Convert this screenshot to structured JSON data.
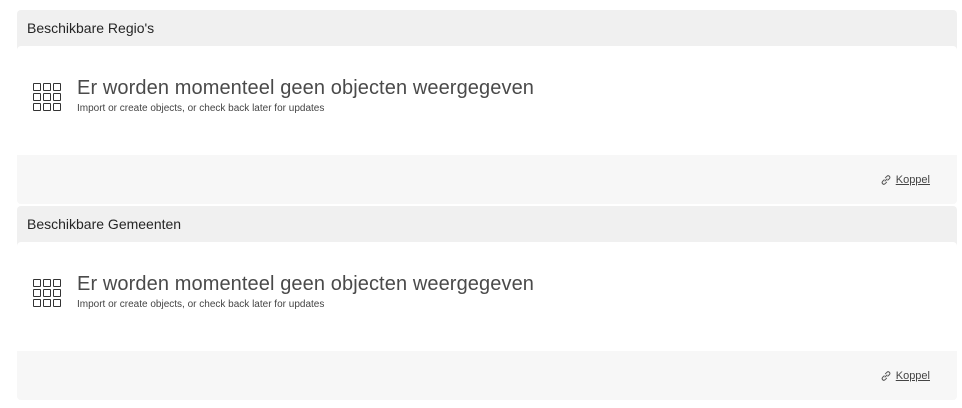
{
  "sections": [
    {
      "title": "Beschikbare Regio's",
      "empty_title": "Er worden momenteel geen objecten weergegeven",
      "empty_subtitle": "Import or create objects, or check back later for updates",
      "link_label": "Koppel",
      "icon": "grid-icon",
      "link_icon": "link-icon"
    },
    {
      "title": "Beschikbare Gemeenten",
      "empty_title": "Er worden momenteel geen objecten weergegeven",
      "empty_subtitle": "Import or create objects, or check back later for updates",
      "link_label": "Koppel",
      "icon": "grid-icon",
      "link_icon": "link-icon"
    }
  ]
}
